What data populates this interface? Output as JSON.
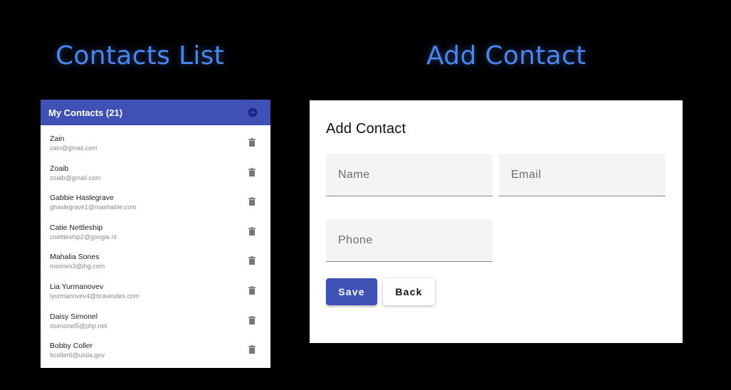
{
  "titles": {
    "left": "Contacts List",
    "right": "Add Contact"
  },
  "contacts": {
    "header_title": "My Contacts (21)",
    "header_icon": "add-circle-icon",
    "item_icon": "delete-icon",
    "items": [
      {
        "name": "Zain",
        "email": "zain@gmail.com"
      },
      {
        "name": "Zoaib",
        "email": "zoaib@gmail.com"
      },
      {
        "name": "Gabbie Haslegrave",
        "email": "ghaslegrave1@mashable.com"
      },
      {
        "name": "Catie Nettleship",
        "email": "cnettleship2@google.nl"
      },
      {
        "name": "Mahalia Sones",
        "email": "msones3@ihg.com"
      },
      {
        "name": "Lia Yurmanovev",
        "email": "lyurmanovev4@bravesites.com"
      },
      {
        "name": "Daisy Simonel",
        "email": "dsimonel5@php.net"
      },
      {
        "name": "Bobby Coller",
        "email": "bcoller6@usda.gov"
      }
    ]
  },
  "form": {
    "title": "Add Contact",
    "name_placeholder": "Name",
    "name_value": "",
    "email_placeholder": "Email",
    "email_value": "",
    "phone_placeholder": "Phone",
    "phone_value": "",
    "save_label": "Save",
    "back_label": "Back"
  },
  "colors": {
    "background": "#000000",
    "title_blue": "#4a86f0",
    "primary": "#3f51b5",
    "field_bg": "#f4f4f4"
  }
}
